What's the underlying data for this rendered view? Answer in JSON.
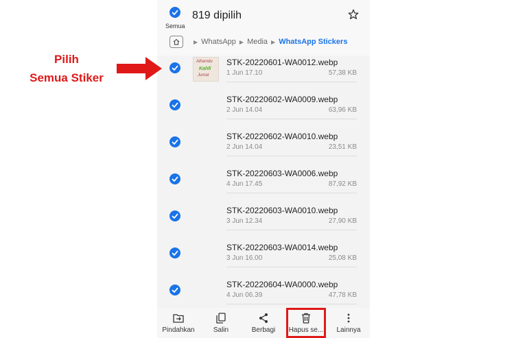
{
  "header": {
    "select_all_label": "Semua",
    "selected_count": "819 dipilih",
    "breadcrumb": [
      "WhatsApp",
      "Media",
      "WhatsApp Stickers"
    ]
  },
  "files": [
    {
      "name": "STK-20220601-WA0012.webp",
      "date": "1 Jun 17.10",
      "size": "57,38 KB",
      "has_thumb": true
    },
    {
      "name": "STK-20220602-WA0009.webp",
      "date": "2 Jun 14.04",
      "size": "63,96 KB"
    },
    {
      "name": "STK-20220602-WA0010.webp",
      "date": "2 Jun 14.04",
      "size": "23,51 KB"
    },
    {
      "name": "STK-20220603-WA0006.webp",
      "date": "4 Jun 17.45",
      "size": "87,92 KB"
    },
    {
      "name": "STK-20220603-WA0010.webp",
      "date": "3 Jun 12.34",
      "size": "27,90 KB"
    },
    {
      "name": "STK-20220603-WA0014.webp",
      "date": "3 Jun 16.00",
      "size": "25,08 KB"
    },
    {
      "name": "STK-20220604-WA0000.webp",
      "date": "4 Jun 06.39",
      "size": "47,78 KB"
    }
  ],
  "bottom_bar": [
    {
      "label": "Pindahkan",
      "icon": "move-icon"
    },
    {
      "label": "Salin",
      "icon": "copy-icon"
    },
    {
      "label": "Berbagi",
      "icon": "share-icon"
    },
    {
      "label": "Hapus se...",
      "icon": "trash-icon",
      "highlighted": true
    },
    {
      "label": "Lainnya",
      "icon": "more-vertical-icon"
    }
  ],
  "annotation": {
    "line1": "Pilih",
    "line2": "Semua Stiker"
  },
  "colors": {
    "accent": "#1a73e8",
    "annotation": "#e01818"
  }
}
